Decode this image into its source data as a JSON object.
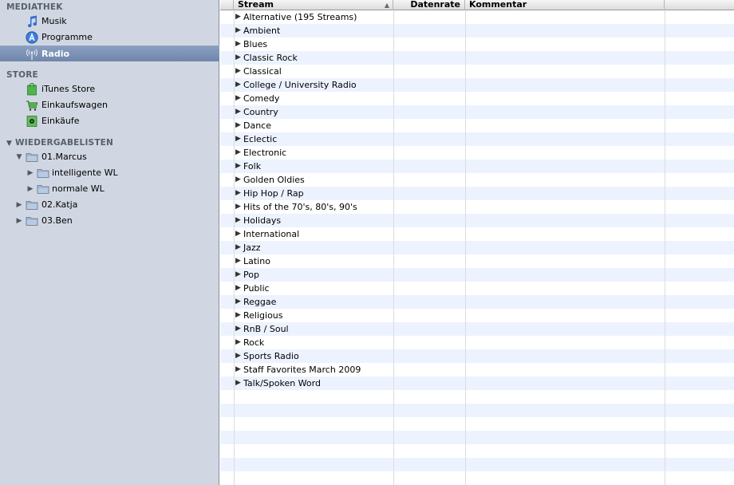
{
  "sidebar": {
    "library_heading": "MEDIATHEK",
    "library": [
      {
        "label": "Musik",
        "icon": "music-note-icon"
      },
      {
        "label": "Programme",
        "icon": "app-store-icon"
      },
      {
        "label": "Radio",
        "icon": "radio-antenna-icon",
        "selected": true
      }
    ],
    "store_heading": "STORE",
    "store": [
      {
        "label": "iTunes Store",
        "icon": "shopping-bag-icon"
      },
      {
        "label": "Einkaufswagen",
        "icon": "shopping-cart-icon"
      },
      {
        "label": "Einkäufe",
        "icon": "purchased-icon"
      }
    ],
    "playlists_heading": "WIEDERGABELISTEN",
    "playlists": [
      {
        "label": "01.Marcus",
        "expanded": true
      },
      {
        "label": "intelligente WL"
      },
      {
        "label": "normale WL"
      },
      {
        "label": "02.Katja",
        "expanded": false
      },
      {
        "label": "03.Ben",
        "expanded": false
      }
    ]
  },
  "table": {
    "columns": [
      "Stream",
      "Datenrate",
      "Kommentar"
    ],
    "rows": [
      "Alternative (195 Streams)",
      "Ambient",
      "Blues",
      "Classic Rock",
      "Classical",
      "College / University Radio",
      "Comedy",
      "Country",
      "Dance",
      "Eclectic",
      "Electronic",
      "Folk",
      "Golden Oldies",
      "Hip Hop / Rap",
      "Hits of the 70's, 80's, 90's",
      "Holidays",
      "International",
      "Jazz",
      "Latino",
      "Pop",
      "Public",
      "Reggae",
      "Religious",
      "RnB / Soul",
      "Rock",
      "Sports Radio",
      "Staff Favorites March 2009",
      "Talk/Spoken Word"
    ]
  },
  "colors": {
    "sidebar_bg": "#d1d7e2",
    "selection": "#7389ad",
    "row_stripe": "#edf3fe"
  }
}
